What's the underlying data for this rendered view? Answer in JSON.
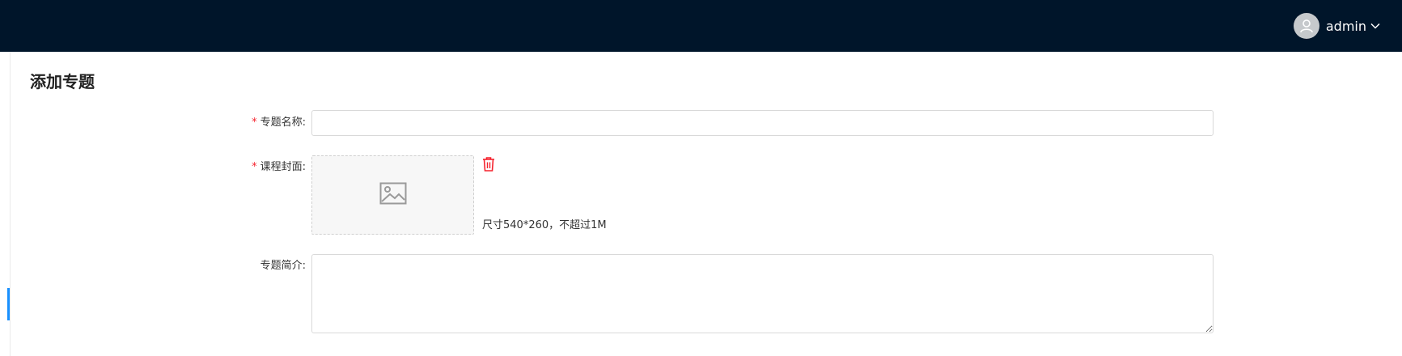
{
  "header": {
    "username": "admin",
    "avatar_icon": "user-icon",
    "dropdown_icon": "chevron-down-icon",
    "background": "#00152a"
  },
  "page": {
    "title": "添加专题"
  },
  "form": {
    "topic_name": {
      "required": true,
      "required_mark": "*",
      "label": "专题名称:",
      "value": "",
      "placeholder": ""
    },
    "cover": {
      "required": true,
      "required_mark": "*",
      "label": "课程封面:",
      "placeholder_icon": "image-icon",
      "delete_icon": "trash-icon",
      "hint": "尺寸540*260，不超过1M"
    },
    "intro": {
      "required": false,
      "label": "专题简介:",
      "value": "",
      "placeholder": ""
    }
  },
  "colors": {
    "accent": "#1890ff",
    "required": "#f5222d",
    "danger_icon": "#f5222d"
  }
}
